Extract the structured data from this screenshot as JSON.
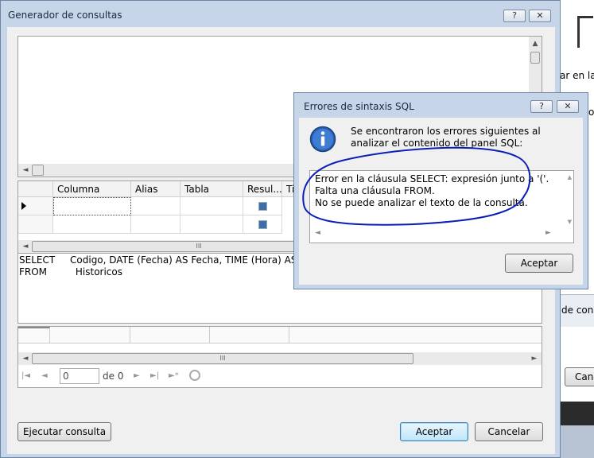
{
  "background": {
    "line1": "ar en la",
    "line2": "o:",
    "line3": "de cons",
    "line4": "Canc"
  },
  "main_dialog": {
    "title": "Generador de consultas",
    "help_label": "?",
    "close_label": "✕",
    "grid": {
      "columns": [
        "Columna",
        "Alias",
        "Tabla",
        "Resul...",
        "Ti"
      ]
    },
    "sql": {
      "line1_kw": "SELECT",
      "line1_text": "Codigo, DATE (Fecha) AS Fecha, TIME (Hora) AS Hora,",
      "line2_kw": "FROM",
      "line2_text": "Historicos"
    },
    "nav": {
      "record_value": "0",
      "of_label": "de 0"
    },
    "buttons": {
      "execute": "Ejecutar consulta",
      "accept": "Aceptar",
      "cancel": "Cancelar"
    }
  },
  "error_dialog": {
    "title": "Errores de sintaxis SQL",
    "help_label": "?",
    "close_label": "✕",
    "message": "Se encontraron los errores siguientes al analizar el contenido del panel SQL:",
    "details": [
      "Error en la cláusula SELECT: expresión junto a '('.",
      "Falta una cláusula FROM.",
      "No se puede analizar el texto de la consulta."
    ],
    "accept": "Aceptar"
  },
  "colors": {
    "annotation": "#0a1fb8",
    "checkbox": "#3d6ea8"
  }
}
